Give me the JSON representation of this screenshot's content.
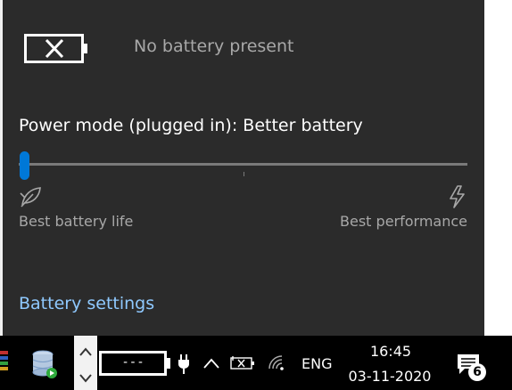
{
  "flyout": {
    "battery_status": "No battery present",
    "power_mode_title": "Power mode (plugged in): Better battery",
    "slider": {
      "value_fraction": 0.0,
      "left_label": "Best battery life",
      "right_label": "Best performance"
    },
    "settings_link": "Battery settings",
    "icons": [
      "battery-missing-icon",
      "leaf-icon",
      "lightning-icon"
    ]
  },
  "taskbar": {
    "battery_indicator_text": "---",
    "language": "ENG",
    "time": "16:45",
    "date": "03-11-2020",
    "notification_count": "6",
    "icons": [
      "app-stack-icon",
      "database-app-icon",
      "chevron-up-icon",
      "chevron-down-icon",
      "power-plug-icon",
      "show-hidden-icons-caret",
      "no-battery-icon",
      "wifi-icon",
      "action-center-icon"
    ]
  },
  "colors": {
    "flyout_bg": "#2b2b2b",
    "accent": "#0078d7",
    "link": "#8fc9ff",
    "secondary_text": "#a8a8a8",
    "taskbar_bg": "#000000"
  }
}
